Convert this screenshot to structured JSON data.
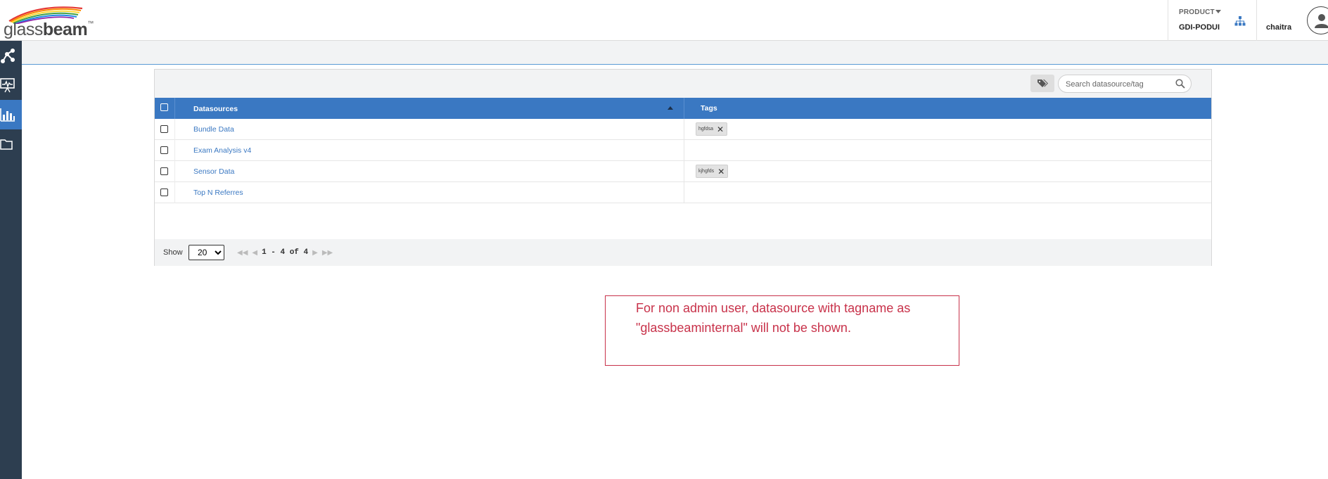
{
  "brand": {
    "name_light": "glass",
    "name_bold": "beam",
    "trademark": "™"
  },
  "header": {
    "product_label": "PRODUCT",
    "product_value": "GDI-PODUI",
    "username": "chaitra"
  },
  "sidebar": {
    "items": [
      {
        "icon": "network-icon",
        "active": false
      },
      {
        "icon": "presentation-chart-icon",
        "active": false
      },
      {
        "icon": "bar-chart-icon",
        "active": true
      },
      {
        "icon": "folder-icon",
        "active": false
      }
    ]
  },
  "toolbar": {
    "search_placeholder": "Search datasource/tag"
  },
  "table": {
    "columns": {
      "datasources": "Datasources",
      "tags": "Tags"
    },
    "rows": [
      {
        "name": "Bundle Data",
        "tag": "hgfdsa"
      },
      {
        "name": "Exam Analysis v4",
        "tag": ""
      },
      {
        "name": "Sensor Data",
        "tag": "kjhgfds"
      },
      {
        "name": "Top N Referres",
        "tag": ""
      }
    ]
  },
  "pagination": {
    "show_label": "Show",
    "page_size": "20",
    "page_size_options": [
      "20"
    ],
    "range_text": "1 - 4 of 4"
  },
  "annotation": {
    "text": "For non admin user, datasource with tagname as \"glassbeaminternal\" will not be shown."
  },
  "colors": {
    "accent": "#3a78c2",
    "sidebar": "#2d3e50",
    "annotation": "#c8324a"
  }
}
